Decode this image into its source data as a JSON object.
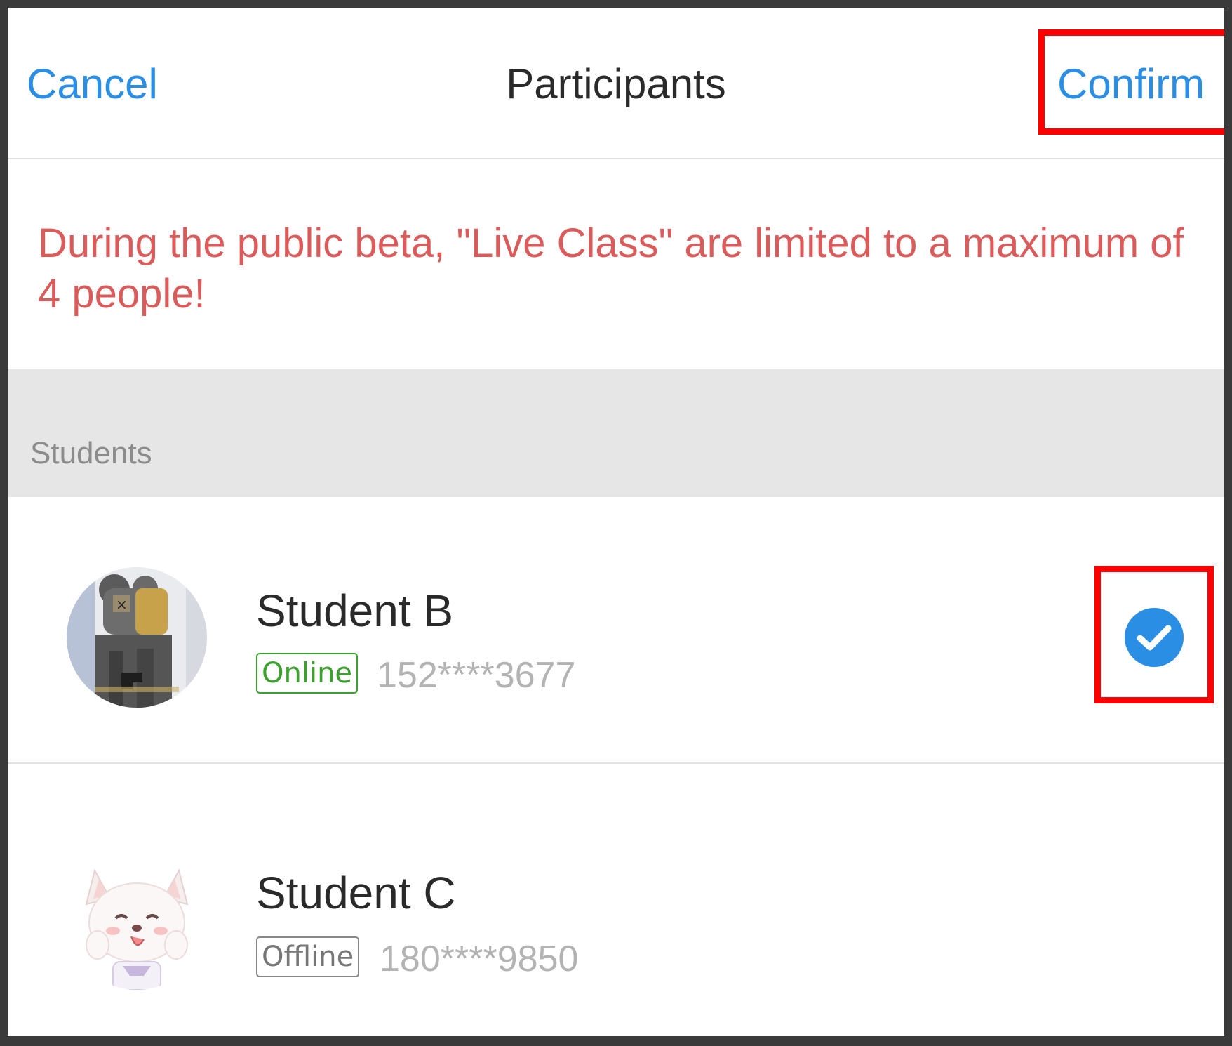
{
  "header": {
    "cancel_label": "Cancel",
    "title": "Participants",
    "confirm_label": "Confirm"
  },
  "notice": {
    "text": "During the public beta, \"Live Class\" are limited to a maximum of 4 people!"
  },
  "section": {
    "label": "Students"
  },
  "students": [
    {
      "name": "Student B",
      "status": "Online",
      "phone": "152****3677",
      "selected": true,
      "avatar_icon": "pixel-bear-figure-avatar"
    },
    {
      "name": "Student C",
      "status": "Offline",
      "phone": "180****9850",
      "selected": false,
      "avatar_icon": "white-dog-cartoon-avatar"
    }
  ],
  "colors": {
    "accent": "#2b8ee5",
    "warning": "#db5a5a",
    "online": "#3aa12c",
    "highlight": "#ff0000"
  }
}
